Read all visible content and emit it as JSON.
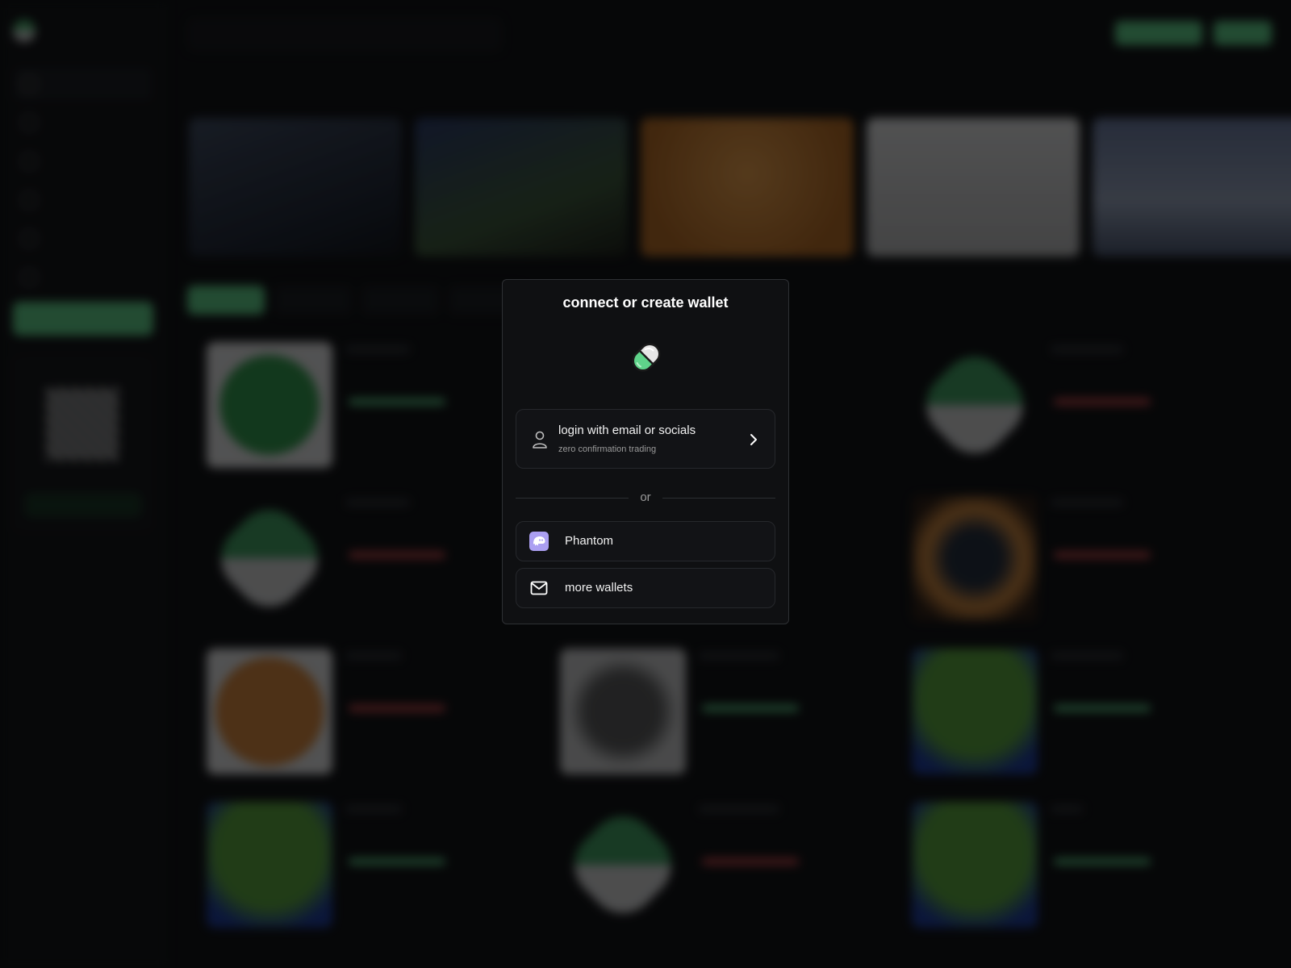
{
  "modal": {
    "title": "connect or create wallet",
    "login_title": "login with email or socials",
    "login_subtitle": "zero confirmation trading",
    "divider_text": "or",
    "phantom_label": "Phantom",
    "more_label": "more wallets"
  },
  "colors": {
    "accent": "#5fd48a",
    "phantom": "#ab9ff2",
    "modal_bg": "#0f1012"
  },
  "icons": {
    "logo": "pill-icon",
    "login": "person-icon",
    "login_arrow": "chevron-right-icon",
    "phantom": "phantom-ghost-icon",
    "more": "mail-icon"
  }
}
